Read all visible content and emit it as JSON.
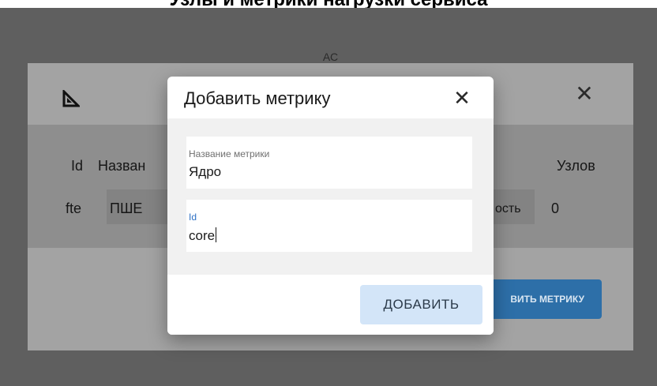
{
  "page": {
    "top_heading": "Узлы и метрики нагрузки сервиса"
  },
  "background_dialog": {
    "subtitle": "АС",
    "logo_icon": "set-square-icon",
    "close_symbol": "✕",
    "table": {
      "headers": [
        "Id",
        "Назван",
        "Узлов"
      ],
      "row": [
        "fte",
        "ПШЕ",
        "ость",
        "0"
      ]
    },
    "add_metric_button_label": "ВИТЬ МЕТРИКУ"
  },
  "modal": {
    "title": "Добавить метрику",
    "close_symbol": "✕",
    "fields": [
      {
        "label": "Название метрики",
        "value": "Ядро"
      },
      {
        "label": "Id",
        "value": "core"
      }
    ],
    "submit_label": "ДОБАВИТЬ"
  },
  "colors": {
    "overlay": "#5f5f5f",
    "accent": "#2f72c4",
    "submit_bg": "#d3e5f8",
    "bg_add_button": "#2d6fa8"
  }
}
